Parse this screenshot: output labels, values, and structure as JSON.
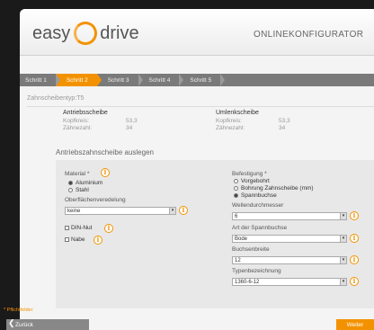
{
  "header": {
    "logo_left": "easy",
    "logo_right": "drive",
    "title": "ONLINEKONFIGURATOR"
  },
  "steps": [
    {
      "label": "Schritt 1",
      "active": false
    },
    {
      "label": "Schritt 2",
      "active": true
    },
    {
      "label": "Schritt 3",
      "active": false
    },
    {
      "label": "Schritt 4",
      "active": false
    },
    {
      "label": "Schritt 5",
      "active": false
    }
  ],
  "subtitle": "Zahnscheibentyp:T5",
  "info": {
    "left": {
      "heading": "Antriebsscheibe",
      "rows": [
        {
          "label": "Kopfkreis:",
          "value": "53,3"
        },
        {
          "label": "Zähnezahl:",
          "value": "34"
        }
      ]
    },
    "right": {
      "heading": "Umlenkscheibe",
      "rows": [
        {
          "label": "Kopfkreis:",
          "value": "53,3"
        },
        {
          "label": "Zähnezahl:",
          "value": "34"
        }
      ]
    }
  },
  "section_title": "Antriebszahnscheibe auslegen",
  "form": {
    "material_label": "Material *",
    "material_options": [
      "Aluminium",
      "Stahl"
    ],
    "material_selected": 0,
    "surface_label": "Oberflächenveredelung",
    "surface_value": "keine",
    "din_nut_label": "DIN-Nut",
    "nabe_label": "Nabe",
    "befestigung_label": "Befestigung *",
    "befestigung_options": [
      "Vorgebohrt",
      "Bohrung Zahnscheibe (mm)",
      "Spannbuchse"
    ],
    "befestigung_selected": 2,
    "welle_label": "Wellendurchmesser",
    "welle_value": "6",
    "spannbuchse_label": "Art der Spannbuchse",
    "spannbuchse_value": "Bode",
    "buchsenbreite_label": "Buchsenbreite",
    "buchsenbreite_value": "12",
    "typ_label": "Typenbezeichnung",
    "typ_value": "1360-6-12",
    "info_glyph": "i"
  },
  "footer": {
    "required_note": "* Pflichtfelder",
    "back_label": "Zurück",
    "next_label": "Weiter"
  },
  "colors": {
    "accent": "#f39200",
    "step_bar": "#7a7a7a"
  }
}
